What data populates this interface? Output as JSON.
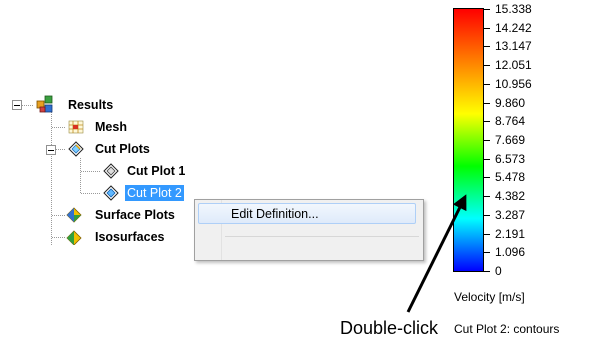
{
  "tree": {
    "root": {
      "label": "Results",
      "icon": "results-icon"
    },
    "items": [
      {
        "label": "Mesh",
        "icon": "mesh-icon"
      },
      {
        "label": "Cut Plots",
        "icon": "cut-plots-icon"
      },
      {
        "label": "Cut Plot 1",
        "icon": "cut-plot-icon"
      },
      {
        "label": "Cut Plot 2",
        "icon": "cut-plot-icon",
        "selected": true
      },
      {
        "label": "Surface Plots",
        "icon": "surface-plots-icon"
      },
      {
        "label": "Isosurfaces",
        "icon": "isosurfaces-icon"
      }
    ]
  },
  "context_menu": {
    "items": [
      "Edit Definition..."
    ]
  },
  "legend": {
    "values": [
      "15.338",
      "14.242",
      "13.147",
      "12.051",
      "10.956",
      "9.860",
      "8.764",
      "7.669",
      "6.573",
      "5.478",
      "4.382",
      "3.287",
      "2.191",
      "1.096",
      "0"
    ],
    "quantity": "Velocity [m/s]",
    "plot_caption": "Cut Plot 2: contours",
    "colors": [
      "#ff0000",
      "#ff8000",
      "#ffff00",
      "#00ff00",
      "#00ffff",
      "#0000ff"
    ]
  },
  "annotation": {
    "text": "Double-click",
    "color": "#000000"
  },
  "selection_color": "#3399ff"
}
